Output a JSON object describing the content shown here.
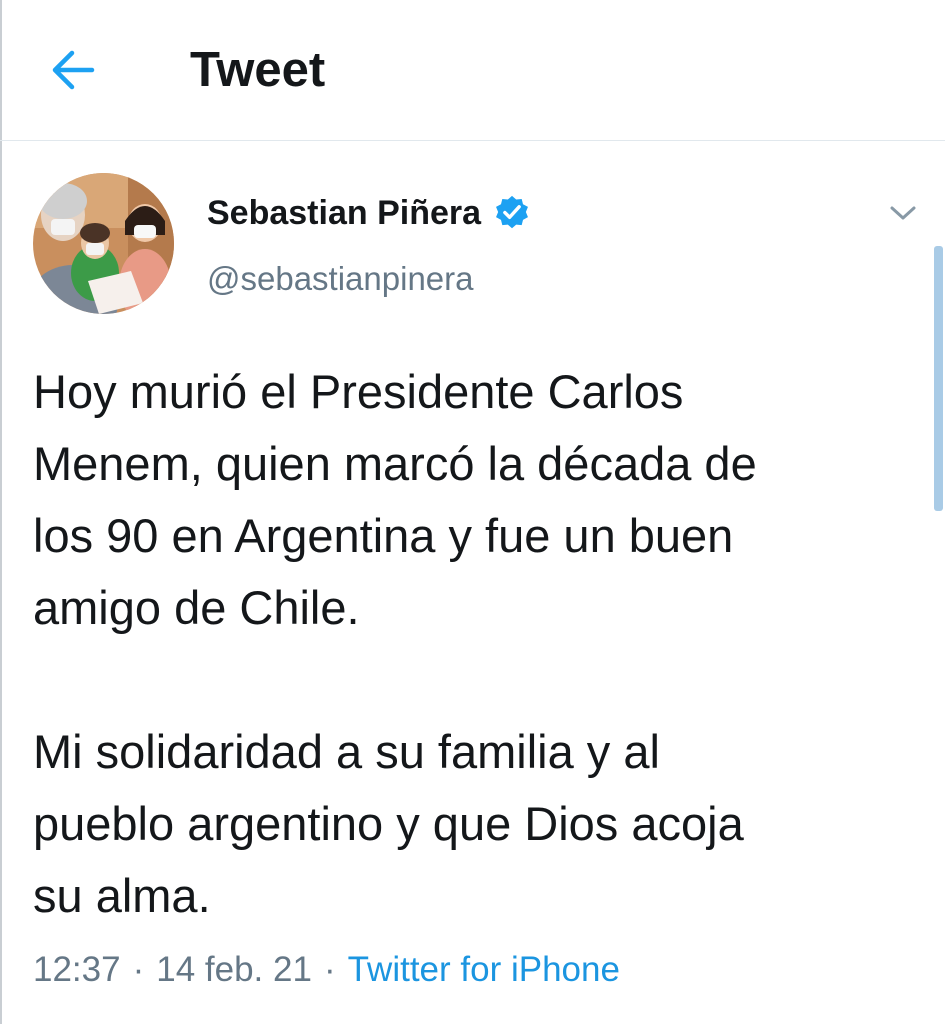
{
  "header": {
    "title": "Tweet",
    "back_icon": "arrow-left-icon"
  },
  "author": {
    "display_name": "Sebastian Piñera",
    "handle": "@sebastianpinera",
    "verified_icon": "verified-badge-icon",
    "avatar": "profile-photo"
  },
  "menu_icon": "chevron-down-icon",
  "tweet": {
    "text": "Hoy murió el Presidente Carlos\nMenem, quien marcó la década de\nlos 90 en Argentina y fue un buen\namigo de Chile.\n\nMi solidaridad a su familia y al\npueblo argentino y que Dios acoja\nsu alma.",
    "time": "12:37",
    "separator": "·",
    "date": "14 feb. 21",
    "source": "Twitter for iPhone"
  },
  "colors": {
    "accent": "#1da1f2",
    "link": "#1b95e0",
    "text_primary": "#14171a",
    "text_secondary": "#657786",
    "divider": "#e1e8ed"
  }
}
